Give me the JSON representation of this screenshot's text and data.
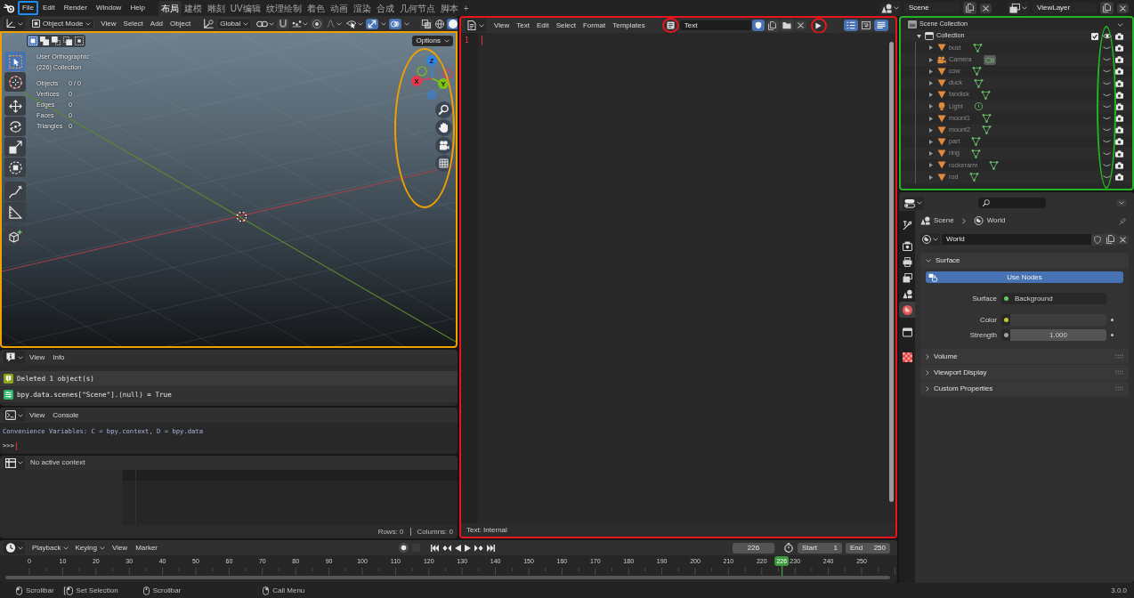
{
  "top_bar": {
    "menus": [
      {
        "label": "File",
        "annotation": {
          "kind": "frame",
          "color": "#1e8cf0"
        }
      },
      {
        "label": "Edit"
      },
      {
        "label": "Render"
      },
      {
        "label": "Window"
      },
      {
        "label": "Help"
      }
    ],
    "workspaces": [
      {
        "label": "布局",
        "selected": true
      },
      {
        "label": "建模",
        "selected": false
      },
      {
        "label": "雕刻",
        "selected": false
      },
      {
        "label": "UV编辑",
        "selected": false
      },
      {
        "label": "纹理绘制",
        "selected": false
      },
      {
        "label": "着色",
        "selected": false
      },
      {
        "label": "动画",
        "selected": false
      },
      {
        "label": "渲染",
        "selected": false
      },
      {
        "label": "合成",
        "selected": false
      },
      {
        "label": "几何节点",
        "selected": false
      },
      {
        "label": "脚本",
        "selected": false
      }
    ],
    "add_workspace": "+",
    "scene": "Scene",
    "view_layer": "ViewLayer"
  },
  "viewport": {
    "annotation": {
      "kind": "frame",
      "color": "#f0a000"
    },
    "header": {
      "mode": "Object Mode",
      "menus": [
        "View",
        "Select",
        "Add",
        "Object"
      ],
      "orientation": "Global",
      "toggles": [
        {
          "kind": "snap",
          "on": false
        },
        {
          "kind": "proportional",
          "on": false
        },
        {
          "kind": "gizmos",
          "on": true
        },
        {
          "kind": "overlays",
          "on": true
        },
        {
          "kind": "xray",
          "on": false
        }
      ],
      "shading": [
        {
          "kind": "wireframe",
          "selected": false
        },
        {
          "kind": "solid",
          "selected": true
        }
      ]
    },
    "select_modes": [
      {
        "kind": "new",
        "selected": true
      },
      {
        "kind": "extend",
        "selected": false
      },
      {
        "kind": "subtract",
        "selected": false
      },
      {
        "kind": "invert",
        "selected": false
      },
      {
        "kind": "intersect",
        "selected": false
      }
    ],
    "options": "Options",
    "tool_groups": [
      [
        {
          "kind": "select_box",
          "selected": true
        },
        {
          "kind": "cursor",
          "selected": false
        }
      ],
      [
        {
          "kind": "move",
          "selected": false
        },
        {
          "kind": "rotate",
          "selected": false
        },
        {
          "kind": "scale",
          "selected": false
        },
        {
          "kind": "transform",
          "selected": false
        }
      ],
      [
        {
          "kind": "annotate",
          "selected": false
        },
        {
          "kind": "measure",
          "selected": false
        }
      ],
      [
        {
          "kind": "add_cube",
          "selected": false
        }
      ]
    ],
    "view_name": "User Orthographic",
    "collection": "(226) Collection",
    "stats": [
      {
        "label": "Objects",
        "value": "0 / 0"
      },
      {
        "label": "Vertices",
        "value": "0"
      },
      {
        "label": "Edges",
        "value": "0"
      },
      {
        "label": "Faces",
        "value": "0"
      },
      {
        "label": "Triangles",
        "value": "0"
      }
    ],
    "navigation": {
      "annotation": {
        "kind": "ellipse",
        "color": "#f0a000"
      },
      "axes": [
        {
          "label": "Z",
          "color": "#2f83e2"
        },
        {
          "label": "X",
          "color": "#e8364f"
        },
        {
          "label": "Y",
          "color": "#7bc216"
        }
      ]
    }
  },
  "info": {
    "menus": [
      "View",
      "Info"
    ],
    "reports": [
      {
        "kind": "info",
        "text": "Deleted 1 object(s)"
      },
      {
        "kind": "operator",
        "text": "bpy.data.scenes[\"Scene\"].(null) = True"
      }
    ]
  },
  "console": {
    "menus": [
      "View",
      "Console"
    ],
    "lines": [
      "Convenience Variables: C = bpy.context, D = bpy.data"
    ],
    "prompt": ">>>",
    "cursor": true
  },
  "spreadsheet": {
    "context": "No active context",
    "rows": "Rows: 0",
    "columns": "Columns: 0"
  },
  "text_editor": {
    "annotation": {
      "kind": "frame",
      "color": "#e8141e"
    },
    "menus": [
      "View",
      "Text",
      "Edit",
      "Select",
      "Format",
      "Templates"
    ],
    "browse": {
      "annotation": {
        "kind": "circle",
        "color": "#e8141e"
      }
    },
    "text_name": "Text",
    "fake_user": true,
    "run_script": {
      "annotation": {
        "kind": "circle",
        "color": "#e8141e"
      }
    },
    "toggles": [
      {
        "kind": "line_numbers",
        "on": true
      },
      {
        "kind": "word_wrap",
        "on": false
      },
      {
        "kind": "syntax",
        "on": true
      }
    ],
    "lines": [
      {
        "number": "1",
        "cursor": true
      }
    ],
    "footer": "Text: Internal"
  },
  "outliner": {
    "annotation": {
      "kind": "frame",
      "color": "#22b422"
    },
    "visibility_annotation": {
      "kind": "ellipse",
      "color": "#22b422"
    },
    "tree": [
      {
        "name": "Scene Collection",
        "kind": "scene_collection",
        "children": [
          {
            "name": "Collection",
            "kind": "collection",
            "expanded": true,
            "checked": true,
            "visible": true,
            "children": [
              {
                "name": "bust",
                "kind": "mesh",
                "expanded": false,
                "visible": false
              },
              {
                "name": "Camera",
                "kind": "camera",
                "expanded": false,
                "visible": false
              },
              {
                "name": "cow",
                "kind": "mesh",
                "expanded": false,
                "visible": false
              },
              {
                "name": "duck",
                "kind": "mesh",
                "expanded": false,
                "visible": false
              },
              {
                "name": "fandisk",
                "kind": "mesh",
                "expanded": false,
                "visible": false
              },
              {
                "name": "Light",
                "kind": "light",
                "expanded": false,
                "visible": false
              },
              {
                "name": "mount1",
                "kind": "mesh",
                "expanded": false,
                "visible": false
              },
              {
                "name": "mount2",
                "kind": "mesh",
                "expanded": false,
                "visible": false
              },
              {
                "name": "part",
                "kind": "mesh",
                "expanded": false,
                "visible": false
              },
              {
                "name": "ring",
                "kind": "mesh",
                "expanded": false,
                "visible": false
              },
              {
                "name": "rockerarm",
                "kind": "mesh",
                "expanded": false,
                "visible": false
              },
              {
                "name": "rod",
                "kind": "mesh",
                "expanded": false,
                "visible": false
              }
            ]
          }
        ]
      }
    ]
  },
  "properties": {
    "tabs": [
      {
        "kind": "tool",
        "selected": false
      },
      {
        "kind": "render",
        "selected": false
      },
      {
        "kind": "output",
        "selected": false
      },
      {
        "kind": "view_layer",
        "selected": false
      },
      {
        "kind": "scene",
        "selected": false
      },
      {
        "kind": "world",
        "selected": true
      },
      {
        "kind": "collection",
        "selected": false
      },
      {
        "kind": "texture",
        "selected": false
      }
    ],
    "breadcrumb": [
      {
        "kind": "scene",
        "label": "Scene"
      },
      {
        "kind": "world",
        "label": "World"
      }
    ],
    "datablock": "World",
    "panels": [
      {
        "title": "Surface",
        "expanded": true,
        "button": "Use Nodes",
        "fields": [
          {
            "label": "Surface",
            "kind": "link",
            "color": "#63c763",
            "value": "Background"
          },
          {
            "label": "Color",
            "kind": "color",
            "color": "#c7c729"
          },
          {
            "label": "Strength",
            "kind": "number",
            "color": "#a1a1a1",
            "value": "1.000"
          }
        ]
      },
      {
        "title": "Volume",
        "expanded": false
      },
      {
        "title": "Viewport Display",
        "expanded": false
      },
      {
        "title": "Custom Properties",
        "expanded": false
      }
    ]
  },
  "timeline": {
    "menus": [
      {
        "label": "Playback",
        "kind": "dropdown"
      },
      {
        "label": "Keying",
        "kind": "dropdown"
      },
      {
        "label": "View",
        "kind": "menu"
      },
      {
        "label": "Marker",
        "kind": "menu"
      }
    ],
    "current_frame": "226",
    "start_label": "Start",
    "start": "1",
    "end_label": "End",
    "end": "250",
    "ruler": {
      "labels": [
        "0",
        "10",
        "20",
        "30",
        "40",
        "50",
        "60",
        "70",
        "80",
        "90",
        "100",
        "110",
        "120",
        "130",
        "140",
        "150",
        "160",
        "170",
        "180",
        "190",
        "200",
        "210",
        "220",
        "230",
        "240",
        "250"
      ],
      "playhead": "226",
      "level": 0.904
    }
  },
  "status_bar": {
    "hints": [
      {
        "kind": "left_click",
        "label": "Scrollbar"
      },
      {
        "kind": "left_drag",
        "label": "Set Selection"
      },
      {
        "kind": "middle_click",
        "label": "Scrollbar"
      },
      {
        "kind": "right_click",
        "label": "Call Menu"
      }
    ],
    "version": "3.0.0"
  }
}
